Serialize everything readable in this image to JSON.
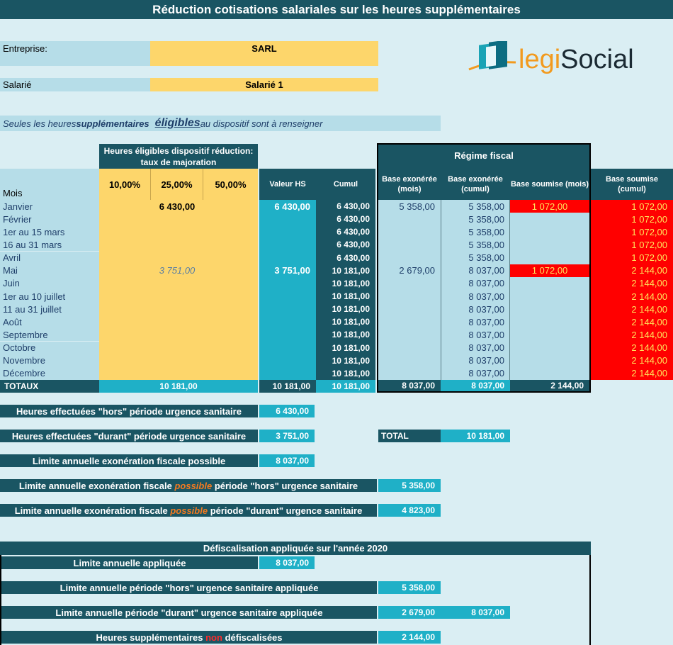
{
  "title": "Réduction cotisations salariales sur les heures supplémentaires",
  "entreprise_label": "Entreprise:",
  "entreprise_value": "SARL",
  "salarie_label": "Salarié",
  "salarie_value": "Salarié 1",
  "note": {
    "p1": "Seules les heures ",
    "p2": "supplémentaires",
    "p3": "éligibles",
    "p4": " au dispositif sont à renseigner"
  },
  "logo": {
    "legi": "legi",
    "social": "Social"
  },
  "group_header": "Heures éligibles dispositif réduction: taux de majoration",
  "rates": [
    "10,00%",
    "25,00%",
    "50,00%"
  ],
  "regime_fiscal": "Régime fiscal",
  "col_headers": {
    "mois": "Mois",
    "valeur_hs": "Valeur HS",
    "cumul": "Cumul",
    "base_exo_mois": "Base exonérée (mois)",
    "base_exo_cumul": "Base exonérée (cumul)",
    "base_soumise_mois": "Base soumise (mois)",
    "base_soumise_cumul": "Base soumise (cumul)"
  },
  "rows": [
    {
      "mois": "Janvier",
      "r25": "6 430,00",
      "r25_style": "b",
      "valeur": "6 430,00",
      "cumul": "6 430,00",
      "exo_mois": "5 358,00",
      "exo_cumul": "5 358,00",
      "soumise_mois": "1 072,00",
      "soumise_cumul": "1 072,00"
    },
    {
      "mois": "Février",
      "r25": "",
      "valeur": "",
      "cumul": "6 430,00",
      "exo_mois": "",
      "exo_cumul": "5 358,00",
      "soumise_mois": "",
      "soumise_cumul": "1 072,00"
    },
    {
      "mois": "1er au 15 mars",
      "r25": "",
      "valeur": "",
      "cumul": "6 430,00",
      "exo_mois": "",
      "exo_cumul": "5 358,00",
      "soumise_mois": "",
      "soumise_cumul": "1 072,00"
    },
    {
      "mois": "16 au 31 mars",
      "r25": "",
      "valeur": "",
      "cumul": "6 430,00",
      "exo_mois": "",
      "exo_cumul": "5 358,00",
      "soumise_mois": "",
      "soumise_cumul": "1 072,00"
    },
    {
      "mois": "Avril",
      "r25": "",
      "valeur": "",
      "cumul": "6 430,00",
      "exo_mois": "",
      "exo_cumul": "5 358,00",
      "soumise_mois": "",
      "soumise_cumul": "1 072,00"
    },
    {
      "mois": "Mai",
      "r25": "3 751,00",
      "r25_style": "i",
      "valeur": "3 751,00",
      "cumul": "10 181,00",
      "exo_mois": "2 679,00",
      "exo_cumul": "8 037,00",
      "soumise_mois": "1 072,00",
      "soumise_cumul": "2 144,00"
    },
    {
      "mois": "Juin",
      "r25": "",
      "valeur": "",
      "cumul": "10 181,00",
      "exo_mois": "",
      "exo_cumul": "8 037,00",
      "soumise_mois": "",
      "soumise_cumul": "2 144,00"
    },
    {
      "mois": "1er au 10 juillet",
      "r25": "",
      "valeur": "",
      "cumul": "10 181,00",
      "exo_mois": "",
      "exo_cumul": "8 037,00",
      "soumise_mois": "",
      "soumise_cumul": "2 144,00"
    },
    {
      "mois": "11 au 31 juillet",
      "r25": "",
      "valeur": "",
      "cumul": "10 181,00",
      "exo_mois": "",
      "exo_cumul": "8 037,00",
      "soumise_mois": "",
      "soumise_cumul": "2 144,00"
    },
    {
      "mois": "Août",
      "r25": "",
      "valeur": "",
      "cumul": "10 181,00",
      "exo_mois": "",
      "exo_cumul": "8 037,00",
      "soumise_mois": "",
      "soumise_cumul": "2 144,00"
    },
    {
      "mois": "Septembre",
      "r25": "",
      "valeur": "",
      "cumul": "10 181,00",
      "exo_mois": "",
      "exo_cumul": "8 037,00",
      "soumise_mois": "",
      "soumise_cumul": "2 144,00"
    },
    {
      "mois": "Octobre",
      "r25": "",
      "valeur": "",
      "cumul": "10 181,00",
      "exo_mois": "",
      "exo_cumul": "8 037,00",
      "soumise_mois": "",
      "soumise_cumul": "2 144,00"
    },
    {
      "mois": "Novembre",
      "r25": "",
      "valeur": "",
      "cumul": "10 181,00",
      "exo_mois": "",
      "exo_cumul": "8 037,00",
      "soumise_mois": "",
      "soumise_cumul": "2 144,00"
    },
    {
      "mois": "Décembre",
      "r25": "",
      "valeur": "",
      "cumul": "10 181,00",
      "exo_mois": "",
      "exo_cumul": "8 037,00",
      "soumise_mois": "",
      "soumise_cumul": "2 144,00"
    }
  ],
  "totaux": {
    "label": "TOTAUX",
    "heures": "10 181,00",
    "valeur": "10 181,00",
    "cumul": "10 181,00",
    "exo_mois": "8 037,00",
    "exo_cumul": "8 037,00",
    "soumise": "2 144,00"
  },
  "summary": {
    "hors_label": "Heures effectuées \"hors\" période urgence sanitaire",
    "hors_value": "6 430,00",
    "durant_label": "Heures effectuées \"durant\" période urgence sanitaire",
    "durant_value": "3 751,00",
    "total_label": "TOTAL",
    "total_value": "10 181,00",
    "limite_label": "Limite annuelle exonération fiscale possible",
    "limite_value": "8 037,00",
    "limite_hors": {
      "p1": "Limite annuelle exonération fiscale ",
      "p2": "possible",
      "p3": " période \"hors\" urgence sanitaire",
      "value": "5 358,00"
    },
    "limite_durant": {
      "p1": "Limite annuelle exonération fiscale ",
      "p2": "possible",
      "p3": " période \"durant\" urgence sanitaire",
      "value": "4 823,00"
    }
  },
  "defisc": {
    "title": "Défiscalisation appliquée sur l'année 2020",
    "appliquee_label": "Limite annuelle appliquée",
    "appliquee_value": "8 037,00",
    "hors_label": "Limite annuelle période \"hors\" urgence sanitaire appliquée",
    "hors_value": "5 358,00",
    "durant_label": "Limite annuelle période \"durant\" urgence sanitaire appliquée",
    "durant_value": "2 679,00",
    "durant_total": "8 037,00",
    "non_defisc": {
      "p1": "Heures supplémentaires ",
      "p2": "non",
      "p3": " défiscalisées",
      "value": "2 144,00"
    }
  },
  "colors": {
    "dark": "#1a5563",
    "teal": "#1fb0c7",
    "yellow": "#fdd66b",
    "light_blue": "#b6dde8",
    "red": "#ff0000",
    "background": "#daeef3",
    "orange_text": "#f47a20"
  }
}
